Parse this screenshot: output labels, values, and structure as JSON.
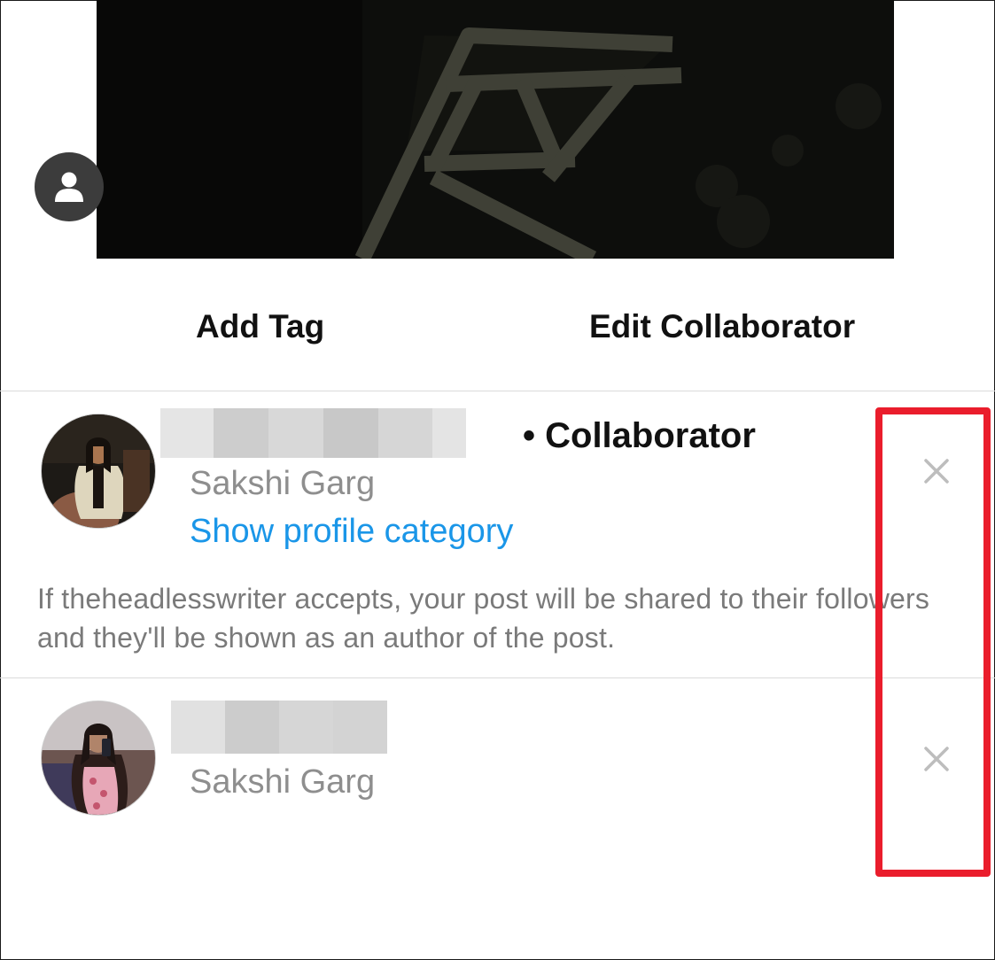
{
  "actions": {
    "add_tag": "Add Tag",
    "edit_collaborator": "Edit Collaborator"
  },
  "collaborator": {
    "role": "• Collaborator",
    "display_name": "Sakshi Garg",
    "show_category": "Show profile category",
    "notice": "If theheadlesswriter accepts, your post will be shared to their followers and they'll be shown as an author of the post."
  },
  "tagged_user": {
    "display_name": "Sakshi Garg"
  },
  "icons": {
    "tag_indicator": "person-icon",
    "remove_collaborator": "close-icon",
    "remove_tag": "close-icon"
  },
  "colors": {
    "link": "#1a96e8",
    "secondary_text": "#8e8e8e",
    "highlight": "#ea1d2c"
  }
}
